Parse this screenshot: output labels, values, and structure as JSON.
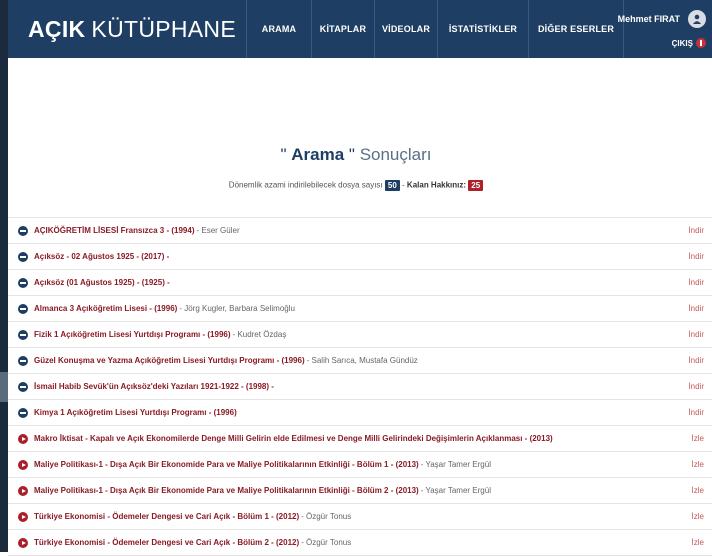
{
  "brand": {
    "bold": "AÇIK",
    "thin": "KÜTÜPHANE"
  },
  "nav": [
    "ARAMA",
    "KİTAPLAR",
    "VİDEOLAR",
    "İSTATİSTİKLER",
    "DİĞER ESERLER"
  ],
  "user": {
    "name": "Mehmet FIRAT",
    "logout": "ÇIKIŞ"
  },
  "heading": {
    "open_quote": "\"",
    "keyword": "Arama",
    "close_quote": "\"",
    "suffix": "Sonuçları"
  },
  "quota": {
    "label": "Dönemlik azami indirilebilecek dosya sayısı",
    "max": "50",
    "separator": "-",
    "remaining_label": "Kalan Hakkınız:",
    "remaining": "25"
  },
  "results": [
    {
      "title": "AÇIKÖĞRETİM LİSESİ Fransızca 3 - (1994)",
      "author": "- Eser Güler",
      "action": "İndir",
      "kind": "download"
    },
    {
      "title": "Açıksöz - 02 Ağustos 1925 - (2017) -",
      "author": "",
      "action": "İndir",
      "kind": "download"
    },
    {
      "title": "Açıksöz (01 Ağustos 1925) - (1925) -",
      "author": "",
      "action": "İndir",
      "kind": "download"
    },
    {
      "title": "Almanca 3 Açıköğretim Lisesi - (1996)",
      "author": "- Jörg Kugler, Barbara Selimoğlu",
      "action": "İndir",
      "kind": "download"
    },
    {
      "title": "Fizik 1 Açıköğretim Lisesi Yurtdışı Programı - (1996)",
      "author": "- Kudret Özdaş",
      "action": "İndir",
      "kind": "download"
    },
    {
      "title": "Güzel Konuşma ve Yazma Açıköğretim Lisesi Yurtdışı Programı - (1996)",
      "author": "- Salih Sarıca, Mustafa Gündüz",
      "action": "İndir",
      "kind": "download"
    },
    {
      "title": "İsmail Habib Sevük'ün Açıksöz'deki Yazıları 1921-1922 - (1998) -",
      "author": "",
      "action": "İndir",
      "kind": "download"
    },
    {
      "title": "Kimya 1 Açıköğretim Lisesi Yurtdışı Programı - (1996)",
      "author": "",
      "action": "İndir",
      "kind": "download"
    },
    {
      "title": "Makro İktisat - Kapalı ve Açık Ekonomilerde Denge Milli Gelirin elde Edilmesi ve Denge Milli Gelirindeki Değişimlerin Açıklanması - (2013)",
      "author": "",
      "action": "İzle",
      "kind": "watch"
    },
    {
      "title": "Maliye Politikası-1 - Dışa Açık Bir Ekonomide Para ve Maliye Politikalarının Etkinliği - Bölüm 1 - (2013)",
      "author": "- Yaşar Tamer Ergül",
      "action": "İzle",
      "kind": "watch"
    },
    {
      "title": "Maliye Politikası-1 - Dışa Açık Bir Ekonomide Para ve Maliye Politikalarının Etkinliği - Bölüm 2 - (2013)",
      "author": "- Yaşar Tamer Ergül",
      "action": "İzle",
      "kind": "watch"
    },
    {
      "title": "Türkiye Ekonomisi - Ödemeler Dengesi ve Cari Açık - Bölüm 1 - (2012)",
      "author": "- Özgür Tonus",
      "action": "İzle",
      "kind": "watch"
    },
    {
      "title": "Türkiye Ekonomisi - Ödemeler Dengesi ve Cari Açık - Bölüm 2 - (2012)",
      "author": "- Özgür Tonus",
      "action": "İzle",
      "kind": "watch"
    }
  ],
  "colors": {
    "navbar": "#1e3f63",
    "accent_red": "#b0202a",
    "title_red": "#8a1a24"
  },
  "icons": {
    "download": "circle-minus-icon",
    "watch": "play-circle-icon",
    "avatar": "user-avatar-icon",
    "logout": "power-icon"
  }
}
